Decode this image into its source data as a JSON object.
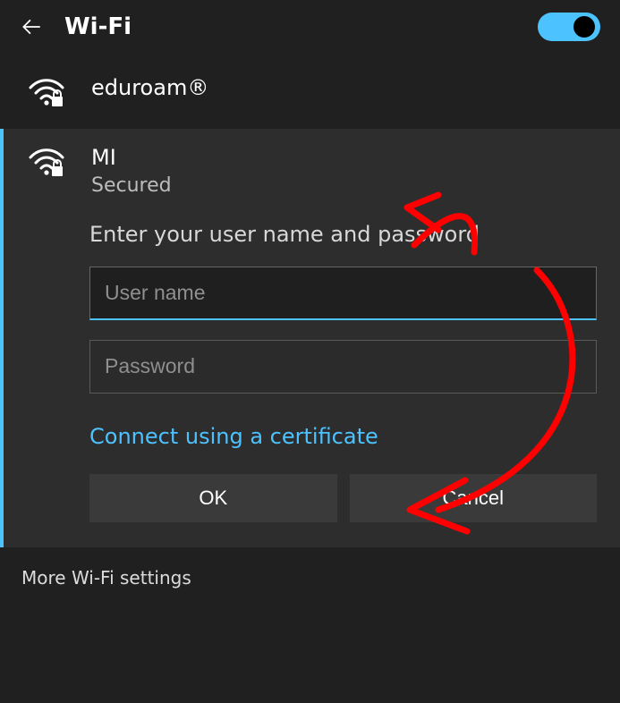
{
  "header": {
    "title": "Wi-Fi",
    "toggle_on": true
  },
  "networks": [
    {
      "name": "eduroam®"
    }
  ],
  "selected": {
    "name": "MI",
    "status": "Secured",
    "prompt": "Enter your user name and password",
    "username_placeholder": "User name",
    "password_placeholder": "Password",
    "cert_link": "Connect using a certificate",
    "ok_label": "OK",
    "cancel_label": "Cancel"
  },
  "footer": {
    "more": "More Wi-Fi settings"
  }
}
